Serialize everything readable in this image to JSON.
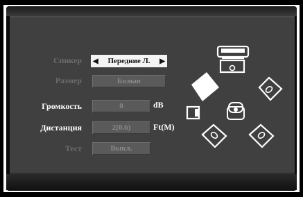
{
  "menu": {
    "rows": [
      {
        "label": "Спикер",
        "value": "Передние Л.",
        "has_arrows": true,
        "selected": true
      },
      {
        "label": "Размер",
        "value": "Больш"
      },
      {
        "label": "Громкость",
        "value": "0",
        "unit": "dB"
      },
      {
        "label": "Дистанция",
        "value": "2(0.6)",
        "unit": "Ft(M)"
      },
      {
        "label": "Тест",
        "value": "Выкл."
      }
    ]
  },
  "colors": {
    "panel": "#404040",
    "selected_field": "#f4f4f4",
    "dim_text": "#6c6c6c"
  },
  "diagram": {
    "icons": [
      "tv-icon",
      "center-speaker-icon",
      "front-left-speaker-icon",
      "front-right-speaker-icon",
      "subwoofer-icon",
      "listener-icon",
      "surround-left-speaker-icon",
      "surround-right-speaker-icon"
    ]
  }
}
